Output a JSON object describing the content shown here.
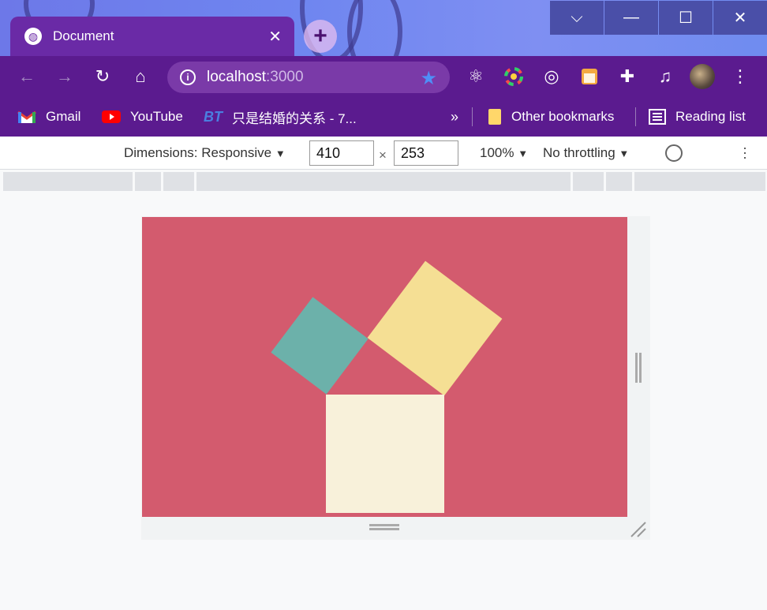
{
  "browser": {
    "tab": {
      "title": "Document"
    },
    "url": {
      "host": "localhost",
      "port": ":3000"
    }
  },
  "bookmarks": {
    "items": [
      {
        "label": "Gmail",
        "icon": "gmail-icon"
      },
      {
        "label": "YouTube",
        "icon": "youtube-icon"
      },
      {
        "label": "只是结婚的关系 - 7...",
        "icon": "bt-icon"
      }
    ],
    "overflow_label": "»",
    "other_bookmarks": "Other bookmarks",
    "reading_list": "Reading list"
  },
  "devtools": {
    "dimensions_label": "Dimensions: Responsive",
    "width": "410",
    "height": "253",
    "times": "×",
    "zoom": "100%",
    "throttling": "No throttling",
    "caret": "▼"
  },
  "page": {
    "background": "#d35b6e",
    "squares": [
      {
        "name": "teal-square",
        "color": "#6cb1aa"
      },
      {
        "name": "yellow-square",
        "color": "#f5df94"
      },
      {
        "name": "cream-square",
        "color": "#f8f1da"
      }
    ]
  }
}
